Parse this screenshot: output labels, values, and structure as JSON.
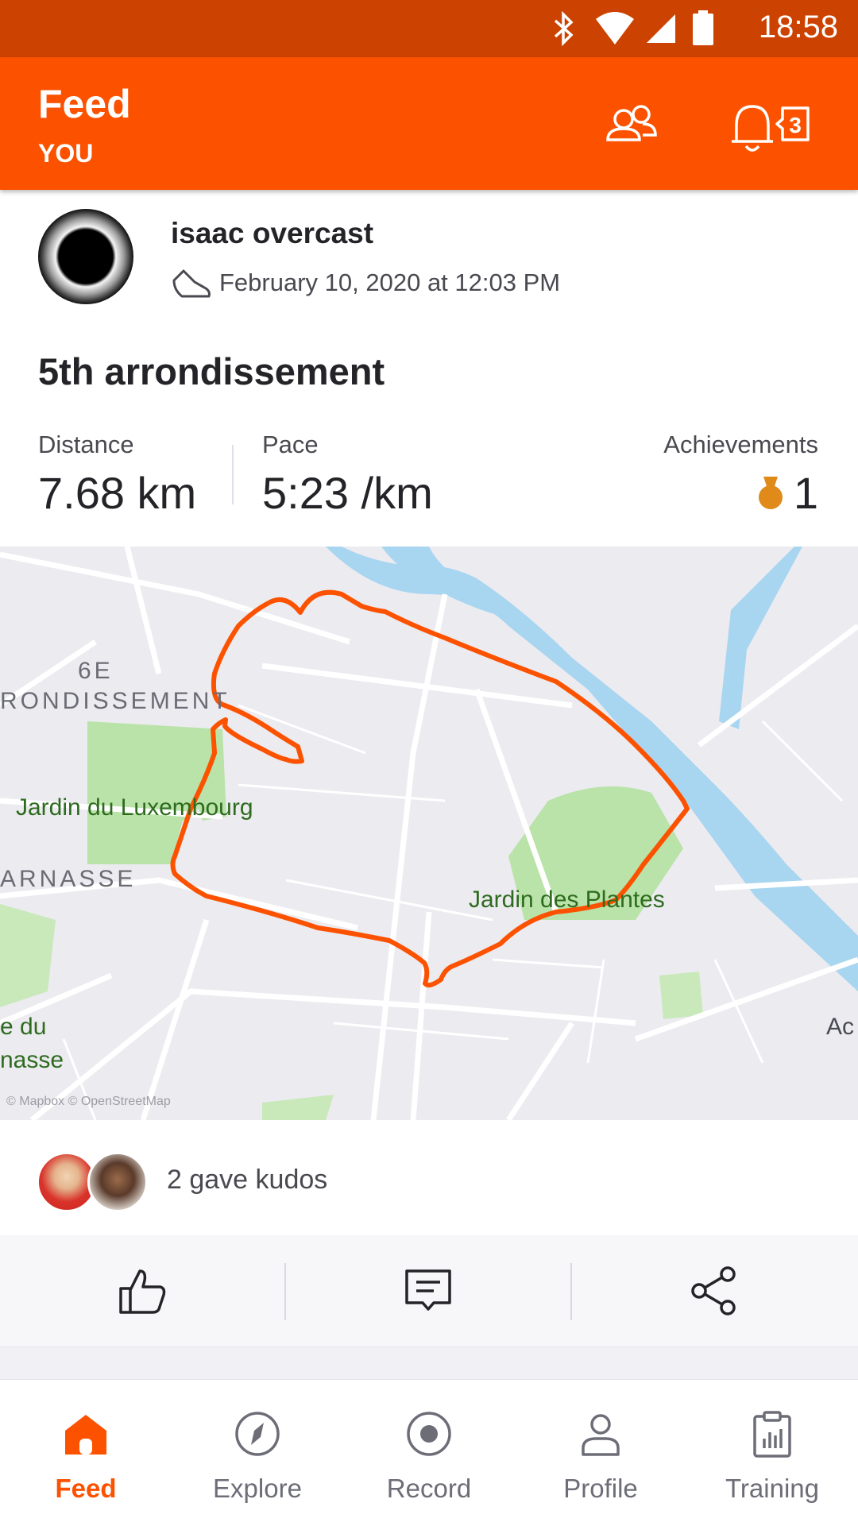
{
  "status_bar": {
    "time": "18:58"
  },
  "header": {
    "title": "Feed",
    "subtitle": "YOU",
    "notification_count": "3"
  },
  "post": {
    "athlete_name": "isaac overcast",
    "activity_type_icon": "shoe-icon",
    "datetime": "February 10, 2020 at 12:03 PM",
    "title": "5th arrondissement",
    "stats": {
      "distance_label": "Distance",
      "distance_value": "7.68 km",
      "pace_label": "Pace",
      "pace_value": "5:23 /km",
      "achievements_label": "Achievements",
      "achievements_value": "1"
    },
    "map": {
      "labels": {
        "district_6e_line1": "6E",
        "district_6e_line2": "RONDISSEMENT",
        "luxembourg": "Jardin du Luxembourg",
        "montparnasse": "ARNASSE",
        "plantes": "Jardin des Plantes",
        "left_edge_line1": "e du",
        "left_edge_line2": "nasse",
        "right_edge": "Ac",
        "attribution": "© Mapbox © OpenStreetMap"
      },
      "route_color": "#fc5200",
      "water_color": "#a8d5f0",
      "park_color": "#b9e3a8"
    },
    "kudos_text": "2 gave kudos"
  },
  "actions": {
    "kudos_icon": "thumbs-up-icon",
    "comment_icon": "comment-icon",
    "share_icon": "share-icon"
  },
  "tabs": [
    {
      "label": "Feed",
      "icon": "home-icon",
      "active": true
    },
    {
      "label": "Explore",
      "icon": "compass-icon"
    },
    {
      "label": "Record",
      "icon": "record-icon"
    },
    {
      "label": "Profile",
      "icon": "person-icon"
    },
    {
      "label": "Training",
      "icon": "clipboard-chart-icon"
    }
  ],
  "colors": {
    "brand": "#fc5200",
    "status_bar": "#cc4200",
    "medal": "#e08a1a"
  }
}
